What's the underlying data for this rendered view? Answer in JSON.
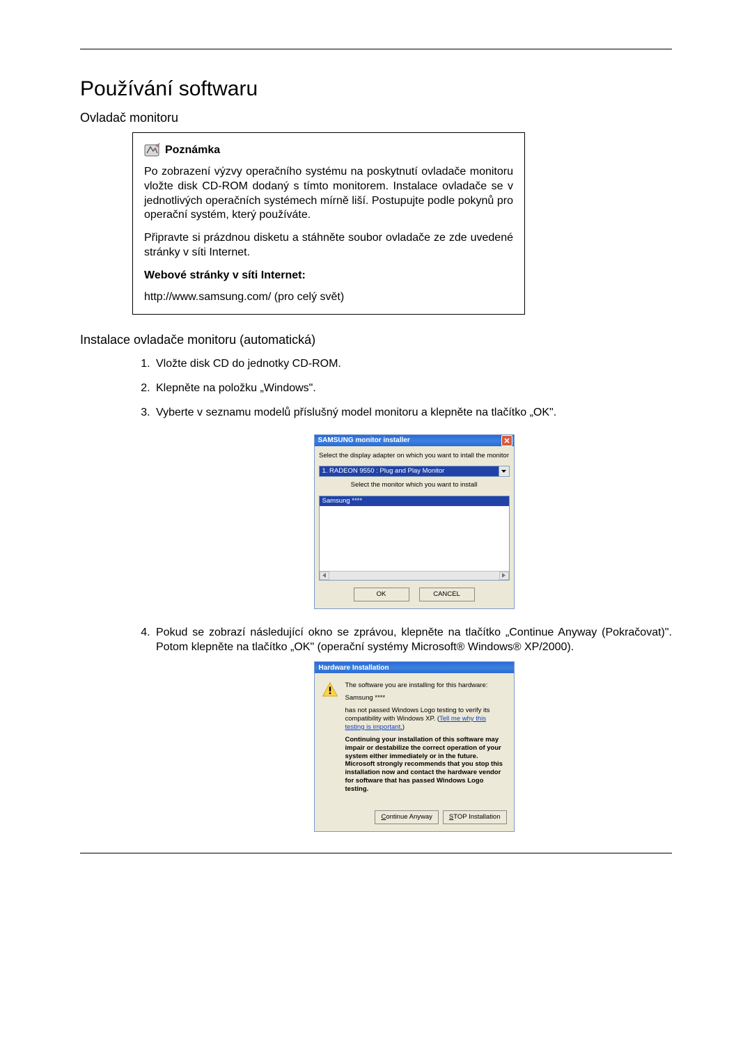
{
  "page_title": "Používání softwaru",
  "section_driver": "Ovladač monitoru",
  "note": {
    "label": "Poznámka",
    "para1": "Po zobrazení výzvy operačního systému na poskytnutí ovladače monitoru vložte disk CD-ROM dodaný s tímto monitorem. Instalace ovladače se v jednotlivých operačních systémech mírně liší. Postupujte podle pokynů pro operační systém, který používáte.",
    "para2": "Připravte si prázdnou disketu a stáhněte soubor ovladače ze zde uvedené stránky v síti Internet.",
    "para3_label": "Webové stránky v síti Internet:",
    "url": "http://www.samsung.com/ (pro celý svět)"
  },
  "section_install": "Instalace ovladače monitoru (automatická)",
  "steps": {
    "s1": "Vložte disk CD do jednotky CD-ROM.",
    "s2": "Klepněte na položku „Windows\".",
    "s3": "Vyberte v seznamu modelů příslušný model monitoru a klepněte na tlačítko „OK\".",
    "s4": "Pokud se zobrazí následující okno se zprávou, klepněte na tlačítko „Continue Anyway (Pokračovat)\". Potom klepněte na tlačítko „OK\" (operační systémy Microsoft® Windows® XP/2000)."
  },
  "dlg1": {
    "title": "SAMSUNG monitor installer",
    "label_adapter": "Select the display adapter on which you want to intall the monitor",
    "adapter_selected": "1. RADEON 9550 : Plug and Play Monitor",
    "label_monitor": "Select the monitor which you want to install",
    "monitor_selected": "Samsung ****",
    "btn_ok": "OK",
    "btn_cancel": "CANCEL"
  },
  "dlg2": {
    "title": "Hardware Installation",
    "line1": "The software you are installing for this hardware:",
    "device": "Samsung ****",
    "line2a": "has not passed Windows Logo testing to verify its compatibility with Windows XP. (",
    "link": "Tell me why this testing is important.",
    "line2b": ")",
    "warn": "Continuing your installation of this software may impair or destabilize the correct operation of your system either immediately or in the future. Microsoft strongly recommends that you stop this installation now and contact the hardware vendor for software that has passed Windows Logo testing.",
    "btn_continue_prefix": "C",
    "btn_continue_rest": "ontinue Anyway",
    "btn_stop_prefix": "S",
    "btn_stop_rest": "TOP Installation"
  }
}
